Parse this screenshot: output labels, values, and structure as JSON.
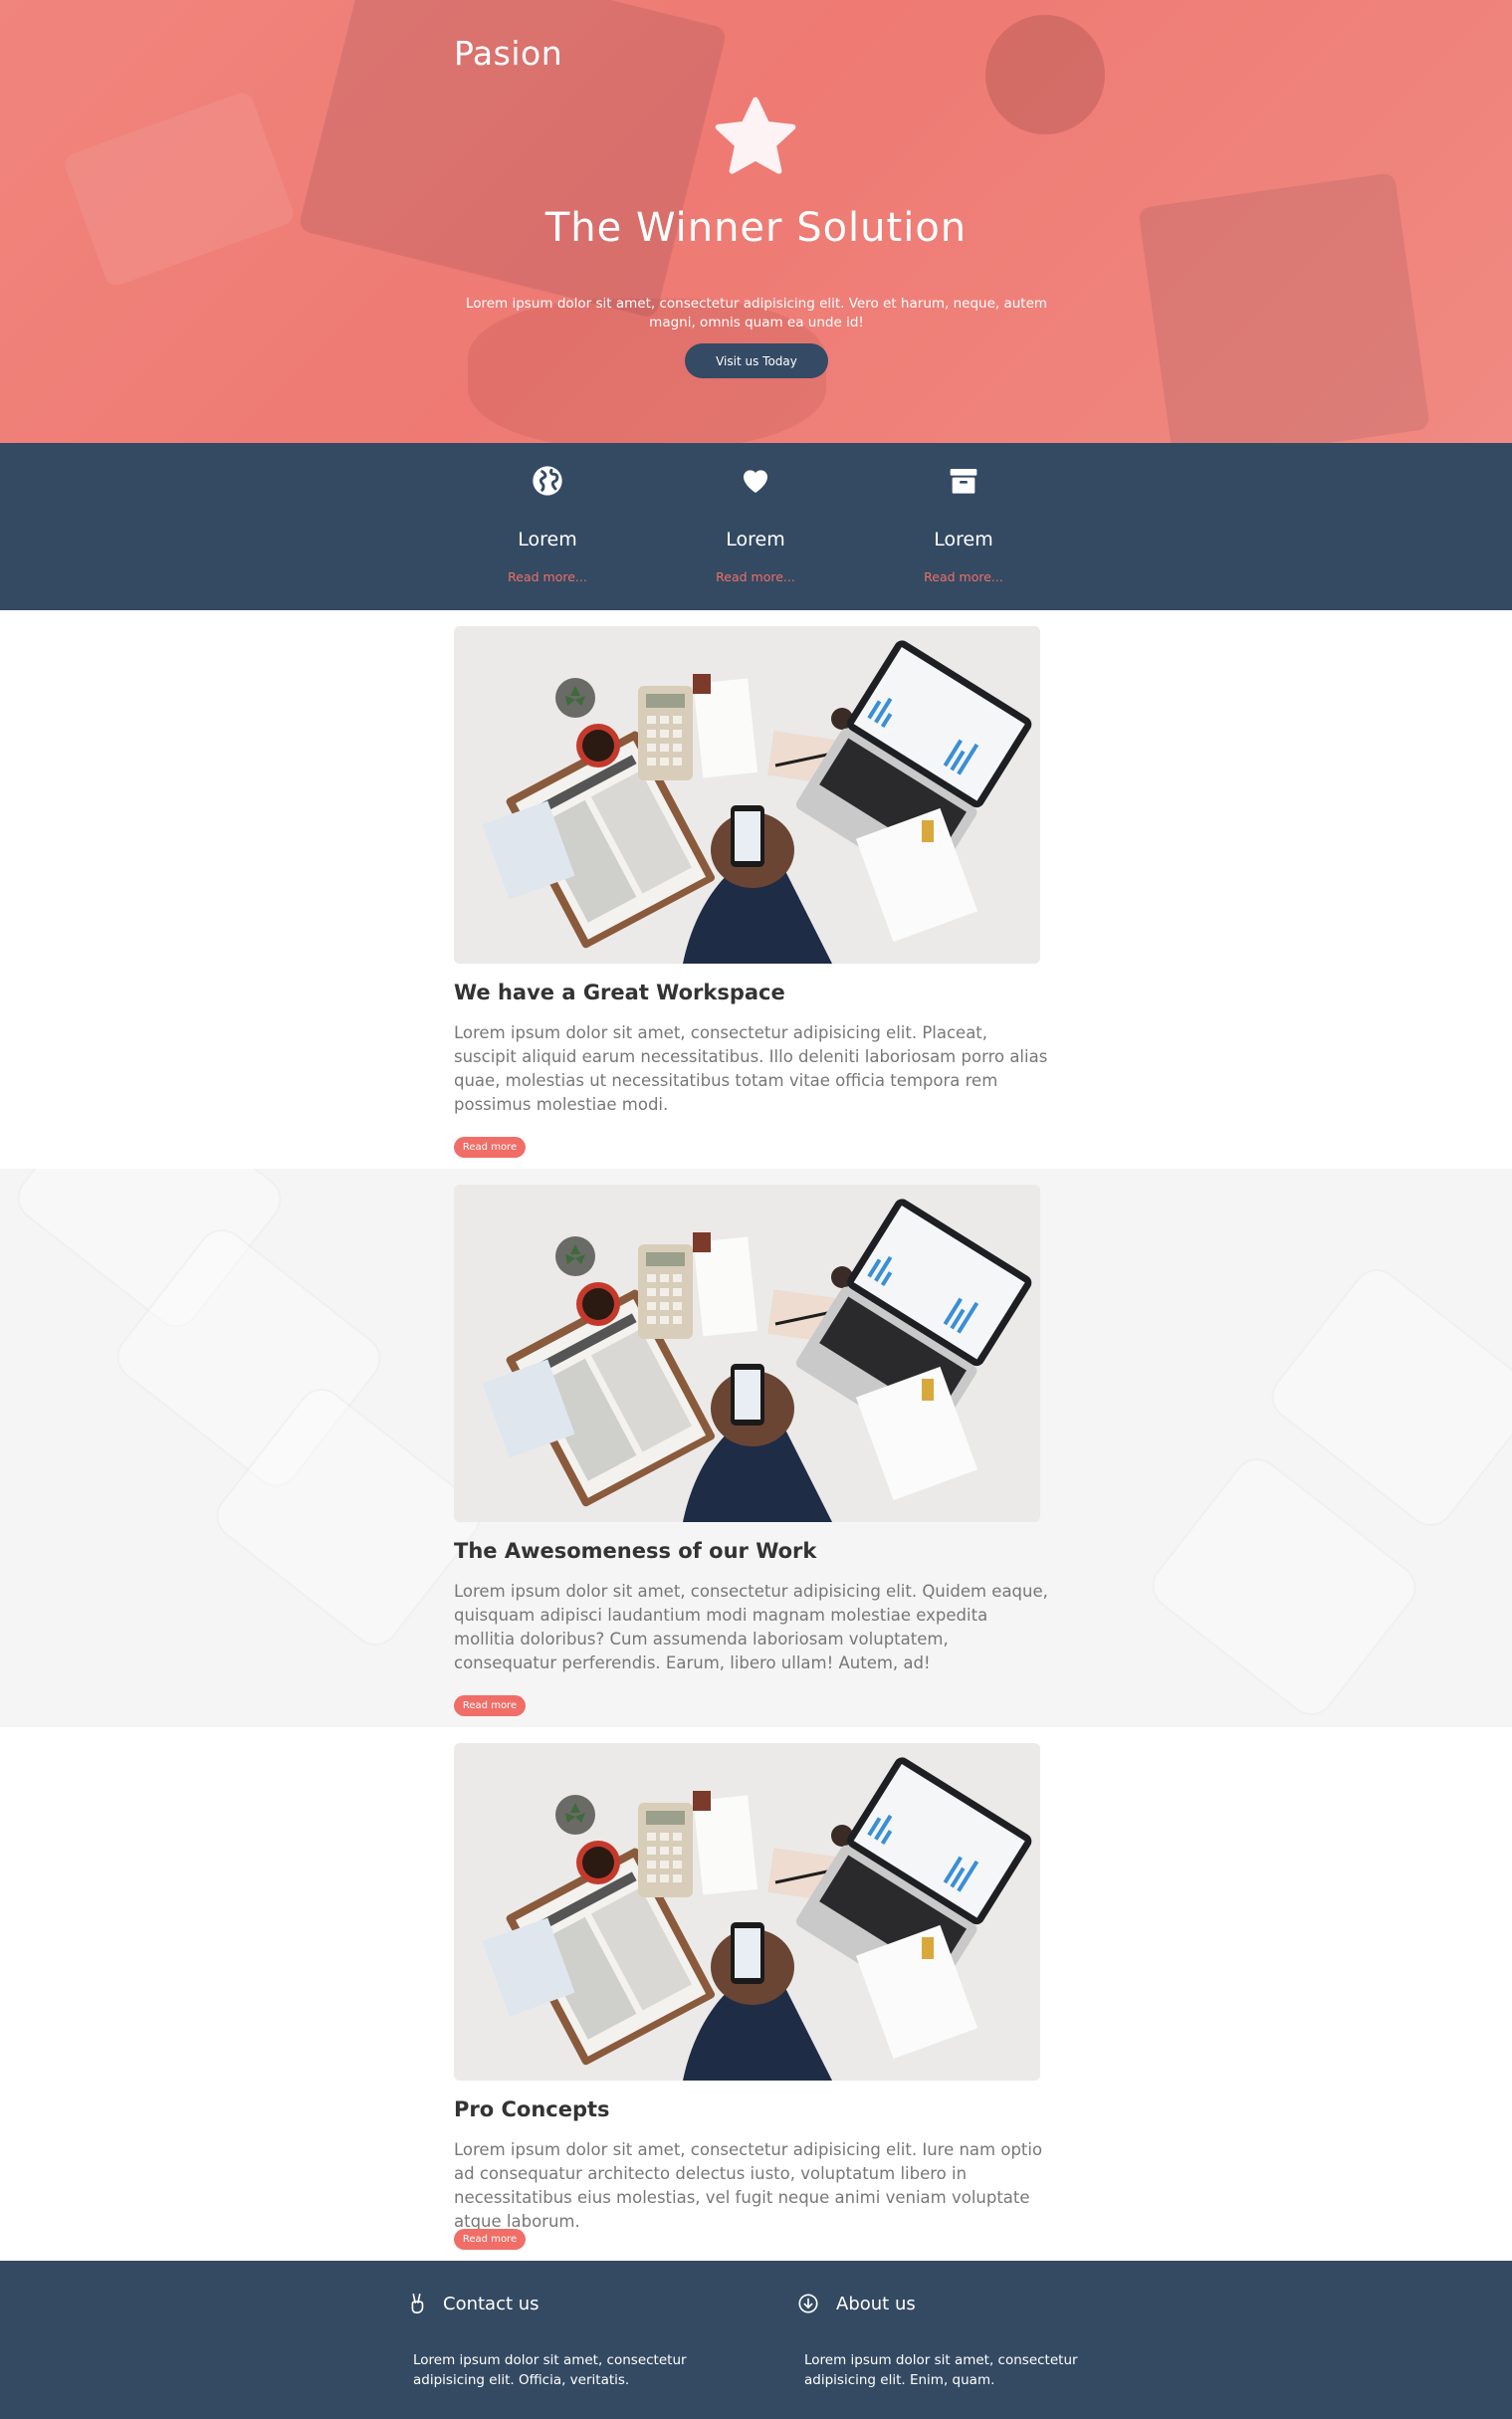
{
  "hero": {
    "brand": "Pasion",
    "title": "The Winner Solution",
    "lead": "Lorem ipsum dolor sit amet, consectetur adipisicing elit. Vero et harum, neque, autem magni, omnis quam ea unde id!",
    "cta_label": "Visit us Today",
    "icon": "star-icon"
  },
  "features": [
    {
      "icon": "globe-icon",
      "title": "Lorem",
      "link": "Read more..."
    },
    {
      "icon": "heart-icon",
      "title": "Lorem",
      "link": "Read more..."
    },
    {
      "icon": "archive-box-icon",
      "title": "Lorem",
      "link": "Read more..."
    }
  ],
  "posts": [
    {
      "title": "We have a Great Workspace",
      "body": "Lorem ipsum dolor sit amet, consectetur adipisicing elit. Placeat, suscipit aliquid earum necessitatibus. Illo deleniti laboriosam porro alias quae, molestias ut necessitatibus totam vitae officia tempora rem possimus molestiae modi.",
      "button": "Read more"
    },
    {
      "title": "The Awesomeness of our Work",
      "body": "Lorem ipsum dolor sit amet, consectetur adipisicing elit. Quidem eaque, quisquam adipisci laudantium modi magnam molestiae expedita mollitia doloribus? Cum assumenda laboriosam voluptatem, consequatur perferendis. Earum, libero ullam! Autem, ad!",
      "button": "Read more"
    },
    {
      "title": "Pro Concepts",
      "body": "Lorem ipsum dolor sit amet, consectetur adipisicing elit. Iure nam optio ad consequatur architecto delectus iusto, voluptatum libero in necessitatibus eius molestias, vel fugit neque animi veniam voluptate atque laborum.",
      "button": "Read more"
    }
  ],
  "footer": {
    "contact": {
      "icon": "victory-hand-icon",
      "title": "Contact us",
      "text": "Lorem ipsum dolor sit amet, consectetur adipisicing elit. Officia, veritatis."
    },
    "about": {
      "icon": "arrow-circle-down-icon",
      "title": "About us",
      "text": "Lorem ipsum dolor sit amet, consectetur adipisicing elit. Enim, quam."
    }
  },
  "colors": {
    "accent": "#f06e67",
    "navy": "#344a63",
    "hero": "#ef8079"
  }
}
